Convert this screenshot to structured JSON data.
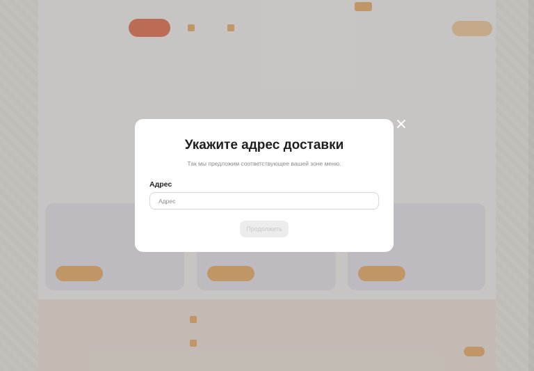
{
  "background": {
    "topbar": {
      "links": [
        "",
        "",
        "",
        ""
      ],
      "account": ""
    },
    "header": {
      "logo_text": "",
      "menu_button": "",
      "nav": [
        "",
        "",
        ""
      ],
      "phone": "",
      "cart": ""
    },
    "breadcrumb": "",
    "page_title": "",
    "promos": [
      {
        "title": "",
        "subtitle": ""
      },
      {
        "title": "",
        "subtitle": ""
      },
      {
        "title": "",
        "subtitle": ""
      }
    ],
    "footer": {
      "logo_text": "",
      "tagline": "",
      "links": [
        "",
        "",
        "",
        "",
        "",
        "",
        "",
        ""
      ]
    }
  },
  "modal": {
    "title": "Укажите адрес доставки",
    "subtitle": "Так мы предложим соответствующее вашей зоне меню.",
    "address_label": "Адрес",
    "address_placeholder": "Адрес",
    "address_value": "",
    "continue_label": "Продолжить",
    "close_icon": "close-icon"
  },
  "colors": {
    "overlay": "rgba(138,138,138,0.46)",
    "modal_bg": "#ffffff",
    "button_disabled_bg": "#ececec",
    "brand_orange": "#e58a24",
    "brand_red": "#e8542a"
  }
}
